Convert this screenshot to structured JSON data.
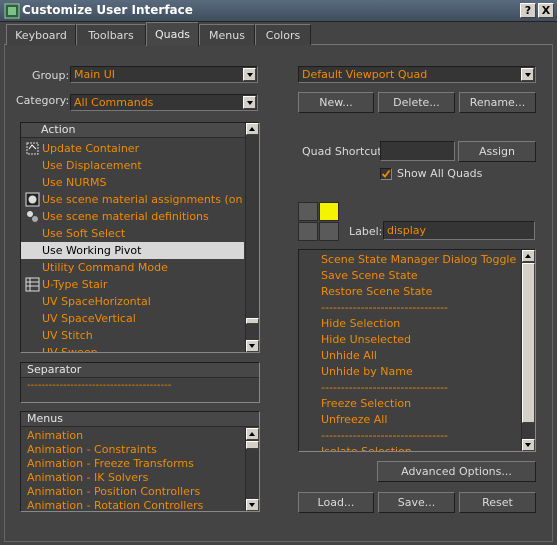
{
  "window": {
    "title": "Customize User Interface",
    "help_btn": "?",
    "close_btn": "X"
  },
  "tabs": [
    {
      "label": "Keyboard",
      "active": false
    },
    {
      "label": "Toolbars",
      "active": false
    },
    {
      "label": "Quads",
      "active": true
    },
    {
      "label": "Menus",
      "active": false
    },
    {
      "label": "Colors",
      "active": false
    }
  ],
  "left": {
    "group_label": "Group:",
    "group_value": "Main UI",
    "category_label": "Category:",
    "category_value": "All Commands",
    "action_header": "Action",
    "actions": [
      {
        "label": "Update Container",
        "icon": "container-update-icon",
        "selected": false
      },
      {
        "label": "Use Displacement",
        "icon": "",
        "selected": false
      },
      {
        "label": "Use NURMS",
        "icon": "",
        "selected": false
      },
      {
        "label": "Use scene material assignments (on R...",
        "icon": "material-assign-icon",
        "selected": false
      },
      {
        "label": "Use scene material definitions",
        "icon": "material-definitions-icon",
        "selected": false
      },
      {
        "label": "Use Soft Select",
        "icon": "",
        "selected": false
      },
      {
        "label": "Use Working Pivot",
        "icon": "",
        "selected": true
      },
      {
        "label": "Utility Command Mode",
        "icon": "",
        "selected": false
      },
      {
        "label": "U-Type Stair",
        "icon": "stair-icon",
        "selected": false
      },
      {
        "label": "UV SpaceHorizontal",
        "icon": "",
        "selected": false
      },
      {
        "label": "UV SpaceVertical",
        "icon": "",
        "selected": false
      },
      {
        "label": "UV Stitch",
        "icon": "",
        "selected": false
      },
      {
        "label": "UV Sweep",
        "icon": "",
        "selected": false
      }
    ],
    "separator_header": "Separator",
    "separator_line": "----------------------------------------",
    "menus_header": "Menus",
    "menus": [
      "Animation",
      "Animation - Constraints",
      "Animation - Freeze Transforms",
      "Animation - IK Solvers",
      "Animation - Position Controllers",
      "Animation - Rotation Controllers"
    ]
  },
  "right": {
    "quad_dropdown": "Default Viewport Quad",
    "new_btn": "New...",
    "delete_btn": "Delete...",
    "rename_btn": "Rename...",
    "quad_shortcut_label": "Quad Shortcut:",
    "quad_shortcut_value": "",
    "assign_btn": "Assign",
    "show_all_quads_label": "Show All Quads",
    "show_all_quads_checked": true,
    "label_label": "Label:",
    "label_value": "display",
    "quad_colors": {
      "active": "#f4f400",
      "inactive": "#5a5a5a"
    },
    "quad_items": [
      "Scene State Manager Dialog Toggle",
      "Save Scene State",
      "Restore Scene State",
      "--------------------------------",
      "Hide Selection",
      "Hide Unselected",
      "Unhide All",
      "Unhide by Name",
      "--------------------------------",
      "Freeze Selection",
      "Unfreeze All",
      "--------------------------------",
      "Isolate Selection"
    ],
    "advanced_btn": "Advanced Options...",
    "load_btn": "Load...",
    "save_btn": "Save...",
    "reset_btn": "Reset"
  }
}
